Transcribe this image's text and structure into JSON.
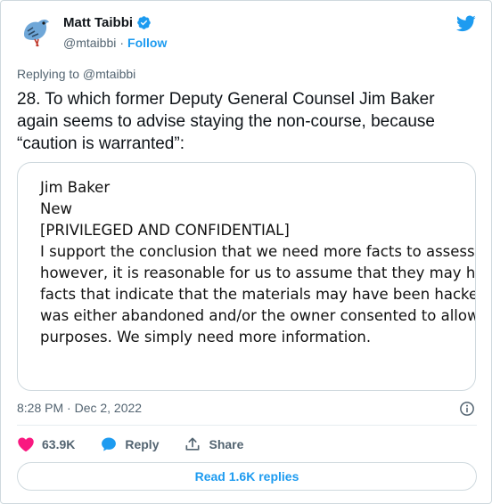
{
  "author": {
    "name": "Matt Taibbi",
    "handle": "@mtaibbi",
    "separator": "·",
    "follow_label": "Follow"
  },
  "tweet": {
    "reply_context": "Replying to @mtaibbi",
    "text_lines": [
      "28. To which former Deputy General Counsel Jim Baker",
      "again seems to advise staying the non-course, because",
      "“caution is warranted”:"
    ],
    "timestamp": "8:28 PM · Dec 2, 2022"
  },
  "document": {
    "lines": [
      "Jim Baker",
      "New",
      "[PRIVILEGED AND CONFIDENTIAL]",
      "I support the conclusion that we need more facts to assess wh",
      "however, it is reasonable for us to assume that they may have",
      "facts that indicate that the materials may have been hacked, w",
      "was either abandoned and/or the owner consented to allow t",
      "purposes. We simply need more information."
    ]
  },
  "actions": {
    "like_count": "63.9K",
    "reply_label": "Reply",
    "share_label": "Share",
    "read_replies_label": "Read 1.6K replies"
  },
  "colors": {
    "accent": "#1d9bf0",
    "like": "#f91880",
    "text": "#0f1419",
    "muted": "#536471"
  },
  "icons": {
    "verified": "verified-badge-icon",
    "brand": "twitter-bird-icon",
    "info": "info-icon",
    "like": "heart-icon",
    "reply": "speech-bubble-icon",
    "share": "share-upload-icon"
  }
}
